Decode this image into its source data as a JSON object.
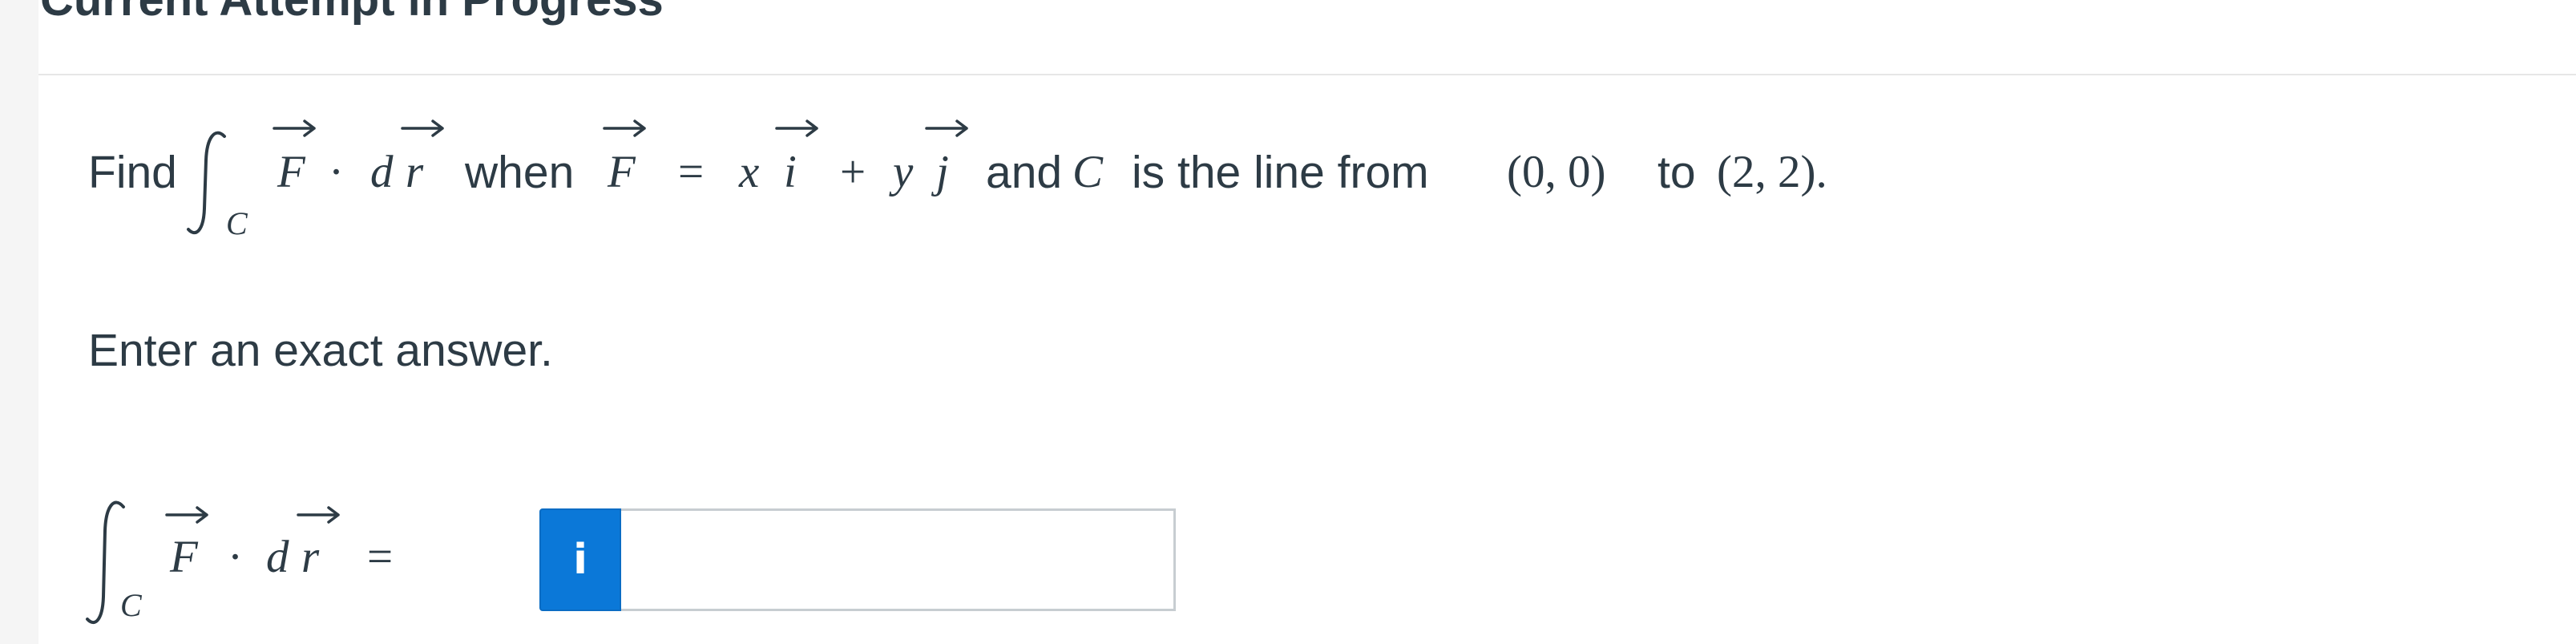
{
  "page": {
    "section_title": "Current Attempt in Progress"
  },
  "question": {
    "find_word": "Find",
    "subscript_c": "C",
    "f_symbol": "F",
    "dot_operator": "·",
    "d_symbol": "d",
    "r_symbol": "r",
    "when_word": "when",
    "equals_sign": "=",
    "x_symbol": "x",
    "i_symbol": "i",
    "plus_sign": "+",
    "y_symbol": "y",
    "j_symbol": "j",
    "and_word": "and",
    "c_symbol": "C",
    "line_text": "is the line from",
    "start_point": "(0, 0)",
    "to_word": "to",
    "end_point": "(2, 2)."
  },
  "instruction": "Enter an exact answer.",
  "answer": {
    "subscript_c": "C",
    "f_symbol": "F",
    "dot_operator": "·",
    "d_symbol": "d",
    "r_symbol": "r",
    "equals_sign": "=",
    "info_glyph": "i",
    "input_value": "",
    "input_placeholder": ""
  }
}
